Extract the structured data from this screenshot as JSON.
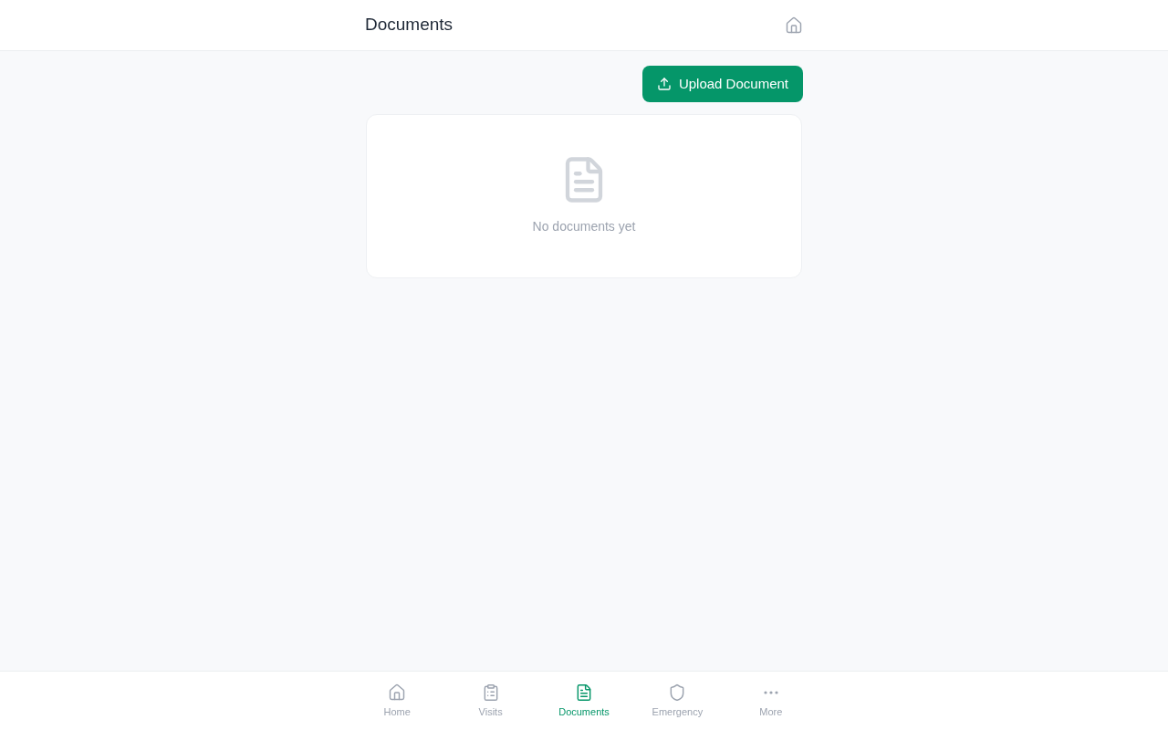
{
  "header": {
    "title": "Documents"
  },
  "upload_button": {
    "label": "Upload Document"
  },
  "empty_state": {
    "message": "No documents yet"
  },
  "bottom_nav": [
    {
      "label": "Home",
      "selected": false
    },
    {
      "label": "Visits",
      "selected": false
    },
    {
      "label": "Documents",
      "selected": true
    },
    {
      "label": "Emergency",
      "selected": false
    },
    {
      "label": "More",
      "selected": false
    }
  ]
}
